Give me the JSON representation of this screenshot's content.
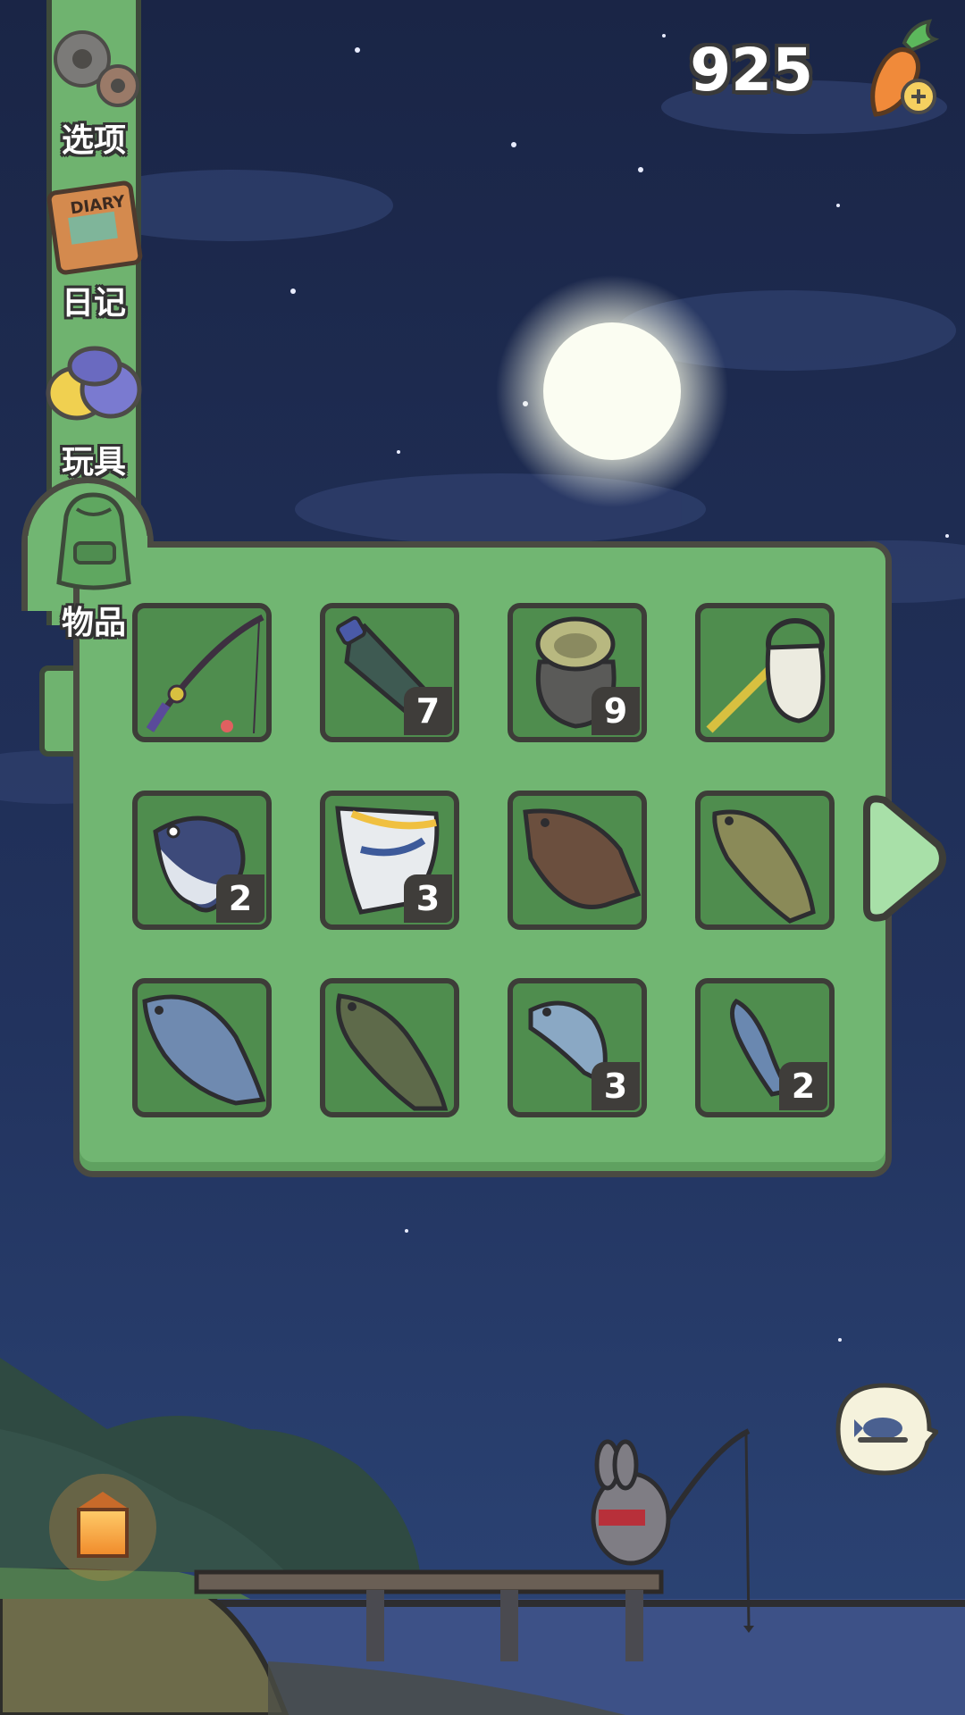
{
  "menu": {
    "items": [
      {
        "label": "选项",
        "icon": "gear-icon"
      },
      {
        "label": "日记",
        "icon": "diary-icon",
        "icon_text": "DIARY"
      },
      {
        "label": "玩具",
        "icon": "toys-icon"
      },
      {
        "label": "物品",
        "icon": "backpack-icon"
      }
    ]
  },
  "currency": {
    "amount": "925",
    "icon": "carrot-plus-icon"
  },
  "inventory": {
    "slots": [
      {
        "item": "fishing-rod",
        "count": ""
      },
      {
        "item": "plastic-bottle",
        "count": "7"
      },
      {
        "item": "bait-bag",
        "count": "9"
      },
      {
        "item": "fishing-net",
        "count": ""
      },
      {
        "item": "tuna",
        "count": "2"
      },
      {
        "item": "triggerfish",
        "count": "3"
      },
      {
        "item": "flounder",
        "count": ""
      },
      {
        "item": "cod",
        "count": ""
      },
      {
        "item": "salmon",
        "count": ""
      },
      {
        "item": "bass",
        "count": ""
      },
      {
        "item": "blue-fish",
        "count": "3"
      },
      {
        "item": "sardine",
        "count": "2"
      }
    ],
    "next_icon": "arrow-right-icon"
  },
  "colors": {
    "panel": "#71b672",
    "slot": "#4f8d4e",
    "outline": "#3d3d38",
    "sky": "#1d2a4e"
  }
}
